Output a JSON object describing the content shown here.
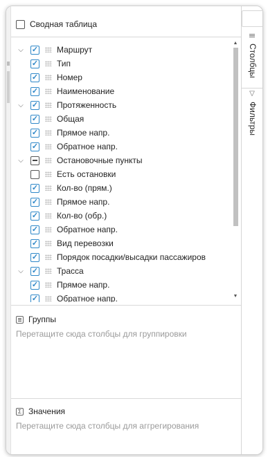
{
  "pivot_mode": {
    "label": "Сводная таблица",
    "checked": false
  },
  "columns_tree": [
    {
      "label": "Маршрут",
      "level": 0,
      "expandable": true,
      "state": "checked"
    },
    {
      "label": "Тип",
      "level": 1,
      "expandable": false,
      "state": "checked"
    },
    {
      "label": "Номер",
      "level": 1,
      "expandable": false,
      "state": "checked"
    },
    {
      "label": "Наименование",
      "level": 1,
      "expandable": false,
      "state": "checked"
    },
    {
      "label": "Протяженность",
      "level": 0,
      "expandable": true,
      "state": "checked"
    },
    {
      "label": "Общая",
      "level": 1,
      "expandable": false,
      "state": "checked"
    },
    {
      "label": "Прямое напр.",
      "level": 1,
      "expandable": false,
      "state": "checked"
    },
    {
      "label": "Обратное напр.",
      "level": 1,
      "expandable": false,
      "state": "checked"
    },
    {
      "label": "Остановочные пункты",
      "level": 0,
      "expandable": true,
      "state": "partial"
    },
    {
      "label": "Есть остановки",
      "level": 1,
      "expandable": false,
      "state": "unchecked"
    },
    {
      "label": "Кол-во (прям.)",
      "level": 1,
      "expandable": false,
      "state": "checked"
    },
    {
      "label": "Прямое напр.",
      "level": 1,
      "expandable": false,
      "state": "checked"
    },
    {
      "label": "Кол-во (обр.)",
      "level": 1,
      "expandable": false,
      "state": "checked"
    },
    {
      "label": "Обратное напр.",
      "level": 1,
      "expandable": false,
      "state": "checked"
    },
    {
      "label": "Вид перевозки",
      "level": 0,
      "expandable": false,
      "state": "checked"
    },
    {
      "label": "Порядок посадки/высадки пассажиров",
      "level": 0,
      "expandable": false,
      "state": "checked"
    },
    {
      "label": "Трасса",
      "level": 0,
      "expandable": true,
      "state": "checked"
    },
    {
      "label": "Прямое напр.",
      "level": 1,
      "expandable": false,
      "state": "checked"
    },
    {
      "label": "Обратное напр.",
      "level": 1,
      "expandable": false,
      "state": "checked"
    }
  ],
  "groups_zone": {
    "title": "Группы",
    "hint": "Перетащите сюда столбцы для группировки",
    "icon": "row-groups-icon"
  },
  "values_zone": {
    "title": "Значения",
    "hint": "Перетащите сюда столбцы для аггрегирования",
    "icon": "sigma-icon",
    "icon_glyph": "Σ"
  },
  "side_tabs": [
    {
      "label": "Столбцы",
      "icon": "columns-icon",
      "active": true
    },
    {
      "label": "Фильтры",
      "icon": "filter-icon",
      "active": false
    }
  ],
  "colors": {
    "accent": "#2e87c8",
    "hint_text": "#9a9a9a",
    "border": "#d6d6d6"
  }
}
